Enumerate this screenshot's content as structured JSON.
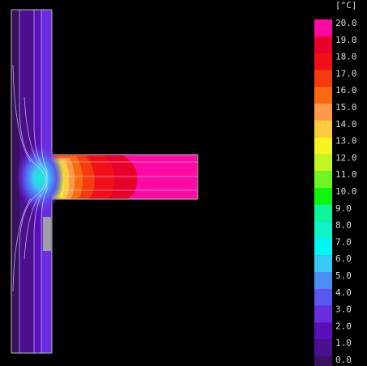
{
  "legend": {
    "unit": "[°C]",
    "labels": [
      "20.0",
      "19.0",
      "18.0",
      "17.0",
      "16.0",
      "15.0",
      "14.0",
      "13.0",
      "12.0",
      "11.0",
      "10.0",
      "9.0",
      "8.0",
      "7.0",
      "6.0",
      "5.0",
      "4.0",
      "3.0",
      "2.0",
      "1.0",
      "0.0"
    ],
    "colors": [
      "#ff0aa5",
      "#e8002c",
      "#f21018",
      "#f73a10",
      "#fa6a10",
      "#ff9a48",
      "#ffcc40",
      "#f5f522",
      "#c2f522",
      "#70f522",
      "#10f510",
      "#10f59a",
      "#10f5c8",
      "#00f5f5",
      "#3cc8f5",
      "#4d8ef5",
      "#5858f0",
      "#6a2ee0",
      "#5a10b8",
      "#4a1090",
      "#3a1060"
    ]
  },
  "wall_bands": [
    "#3a1060",
    "#4a1090",
    "#5a10b8",
    "#6a2ee0"
  ]
}
